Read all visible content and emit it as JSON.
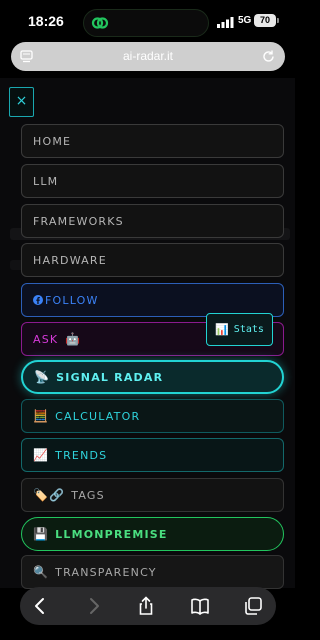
{
  "status_bar": {
    "time": "18:26",
    "network": "5G",
    "battery": "70"
  },
  "browser": {
    "url": "ai-radar.it"
  },
  "menu": {
    "close_label": "×",
    "items": [
      {
        "label": "HOME",
        "icon": ""
      },
      {
        "label": "LLM",
        "icon": ""
      },
      {
        "label": "FRAMEWORKS",
        "icon": ""
      },
      {
        "label": "HARDWARE",
        "icon": ""
      },
      {
        "label": "FOLLOW",
        "icon": "facebook-icon"
      },
      {
        "label": "ASK",
        "icon": "robot-icon"
      },
      {
        "label": "SIGNAL RADAR",
        "icon": "satellite-dish-icon"
      },
      {
        "label": "CALCULATOR",
        "icon": "abacus-icon"
      },
      {
        "label": "TRENDS",
        "icon": "chart-increasing-icon"
      },
      {
        "label": "TAGS",
        "icon": "tag-link-icon"
      },
      {
        "label": "LLMONPREMISE",
        "icon": "floppy-disk-icon"
      },
      {
        "label": "TRANSPARENCY",
        "icon": "magnifier-icon"
      }
    ],
    "stats_label": "Stats"
  },
  "colors": {
    "accent_cyan": "#22d3d3",
    "follow_blue": "#3b82f6",
    "ask_magenta": "#d63ad8",
    "llm_green": "#4ade80"
  }
}
